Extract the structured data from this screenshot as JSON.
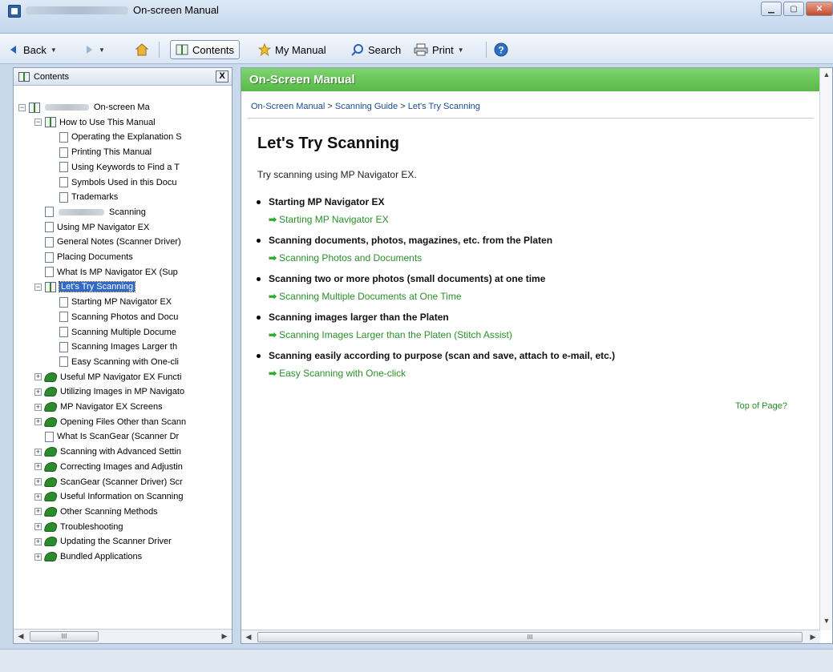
{
  "window": {
    "title": "On-screen Manual"
  },
  "toolbar": {
    "back_label": "Back",
    "contents_label": "Contents",
    "my_manual_label": "My Manual",
    "search_label": "Search",
    "print_label": "Print"
  },
  "left_panel": {
    "title": "Contents",
    "close_glyph": "X",
    "scroll_thumb_glyph": "III",
    "tree": [
      {
        "label": "On-screen Ma",
        "icon": "book-icon",
        "expander": "−",
        "blurred": true
      },
      {
        "label": "How to Use This Manual",
        "icon": "book-icon",
        "expander": "−"
      },
      {
        "label": "Operating the Explanation S",
        "icon": "page-icon"
      },
      {
        "label": "Printing This Manual",
        "icon": "page-icon"
      },
      {
        "label": "Using Keywords to Find a T",
        "icon": "page-icon"
      },
      {
        "label": "Symbols Used in this Docu",
        "icon": "page-icon"
      },
      {
        "label": "Trademarks",
        "icon": "page-icon"
      },
      {
        "label": "Scanning",
        "icon": "page-icon",
        "blurred": true
      },
      {
        "label": "Using MP Navigator EX",
        "icon": "page-icon"
      },
      {
        "label": "General Notes (Scanner Driver)",
        "icon": "page-icon"
      },
      {
        "label": "Placing Documents",
        "icon": "page-icon"
      },
      {
        "label": "What Is MP Navigator EX (Sup",
        "icon": "page-icon"
      },
      {
        "label": "Let's Try Scanning",
        "icon": "book-icon",
        "expander": "−",
        "selected": true
      },
      {
        "label": "Starting MP Navigator EX",
        "icon": "page-icon"
      },
      {
        "label": "Scanning Photos and Docu",
        "icon": "page-icon"
      },
      {
        "label": "Scanning Multiple Docume",
        "icon": "page-icon"
      },
      {
        "label": "Scanning Images Larger th",
        "icon": "page-icon"
      },
      {
        "label": "Easy Scanning with One-cli",
        "icon": "page-icon"
      },
      {
        "label": "Useful MP Navigator EX Functi",
        "icon": "green-book-icon",
        "expander": "+"
      },
      {
        "label": "Utilizing Images in MP Navigato",
        "icon": "green-book-icon",
        "expander": "+"
      },
      {
        "label": "MP Navigator EX Screens",
        "icon": "green-book-icon",
        "expander": "+"
      },
      {
        "label": "Opening Files Other than Scann",
        "icon": "green-book-icon",
        "expander": "+"
      },
      {
        "label": "What Is ScanGear (Scanner Dr",
        "icon": "page-icon"
      },
      {
        "label": "Scanning with Advanced Settin",
        "icon": "green-book-icon",
        "expander": "+"
      },
      {
        "label": "Correcting Images and Adjustin",
        "icon": "green-book-icon",
        "expander": "+"
      },
      {
        "label": "ScanGear (Scanner Driver) Scr",
        "icon": "green-book-icon",
        "expander": "+"
      },
      {
        "label": "Useful Information on Scanning",
        "icon": "green-book-icon",
        "expander": "+"
      },
      {
        "label": "Other Scanning Methods",
        "icon": "green-book-icon",
        "expander": "+"
      },
      {
        "label": "Troubleshooting",
        "icon": "green-book-icon",
        "expander": "+"
      },
      {
        "label": "Updating the Scanner Driver",
        "icon": "green-book-icon",
        "expander": "+"
      },
      {
        "label": "Bundled Applications",
        "icon": "green-book-icon",
        "expander": "+"
      }
    ]
  },
  "main": {
    "header": "On-Screen Manual",
    "breadcrumb": [
      "On-Screen Manual",
      "Scanning Guide",
      "Let's Try Scanning"
    ],
    "breadcrumb_separator": ">",
    "title": "Let's Try Scanning",
    "intro": "Try scanning using MP Navigator EX.",
    "arrow_glyph": "➡",
    "items": [
      {
        "heading": "Starting MP Navigator EX",
        "link": "Starting MP Navigator EX"
      },
      {
        "heading": "Scanning documents, photos, magazines, etc. from the Platen",
        "link": "Scanning Photos and Documents"
      },
      {
        "heading": "Scanning two or more photos (small documents) at one time",
        "link": "Scanning Multiple Documents at One Time"
      },
      {
        "heading": "Scanning images larger than the Platen",
        "link": "Scanning Images Larger than the Platen (Stitch Assist)"
      },
      {
        "heading": "Scanning easily according to purpose (scan and save, attach to e-mail, etc.)",
        "link": "Easy Scanning with One-click"
      }
    ],
    "top_of_page": "Top of Page?",
    "scroll_thumb_glyph": "III"
  },
  "colors": {
    "header_green": "#58b948",
    "link_green": "#2a8f2a",
    "selection_blue": "#3169c6"
  }
}
